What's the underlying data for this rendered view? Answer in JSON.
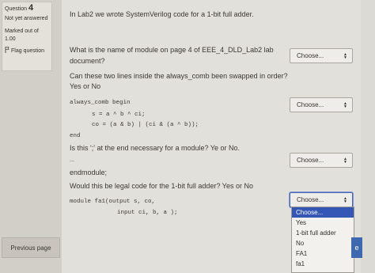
{
  "sidebar": {
    "question_prefix": "Question",
    "question_number": "4",
    "status": "Not yet answered",
    "marked_label": "Marked out of",
    "marked_value": "1.00",
    "flag_label": "Flag question",
    "previous_page": "Previous page"
  },
  "content": {
    "intro": "In Lab2 we wrote SystemVerilog code for a 1-bit full adder.",
    "q1_line1": "What is the name of module on page 4 of EEE_4_DLD_Lab2 lab",
    "q1_line2": "document?",
    "q2_line1": "Can these two lines inside the always_comb been swapped in order?",
    "q2_line2": "Yes or No",
    "code1_line1": "always_comb begin",
    "code1_line2": "s = a ^ b ^ ci;",
    "code1_line3": "co = (a & b) | (ci & (a ^ b));",
    "code1_line4": "end",
    "q3": "Is this ';' at the end necessary for a module? Ye or No.",
    "dots": "...",
    "endmodule": "endmodule;",
    "q4": "Would this be legal code for the 1-bit full adder? Yes or No",
    "code2_line1": "module fa1(output s, co,",
    "code2_line2": "input ci, b, a );"
  },
  "selects": {
    "s1": "Choose...",
    "s2": "Choose...",
    "s3": "Choose...",
    "s4": "Choose..."
  },
  "dropdown": {
    "options": [
      "Choose...",
      "Yes",
      "1-bit full adder",
      "No",
      "FA1",
      "fa1"
    ]
  },
  "next_partial": "e"
}
